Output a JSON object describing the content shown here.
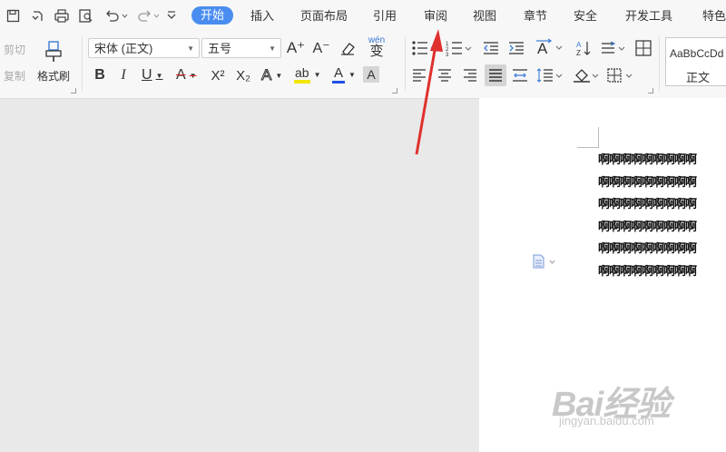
{
  "tabs": [
    "开始",
    "插入",
    "页面布局",
    "引用",
    "审阅",
    "视图",
    "章节",
    "安全",
    "开发工具",
    "特色"
  ],
  "quick_access": [
    "save-icon",
    "redo-file-icon",
    "print-icon",
    "print-preview-icon",
    "undo-icon",
    "redo-icon",
    "customize-icon"
  ],
  "clipboard": {
    "cut": "剪切",
    "copy": "复制",
    "format_painter": "格式刷"
  },
  "font": {
    "name": "宋体 (正文)",
    "size": "五号"
  },
  "font_buttons": {
    "bold": "B",
    "italic": "I",
    "underline": "U",
    "strike": "A",
    "superscript": "X²",
    "subscript": "X₂",
    "text_effect": "A",
    "highlight": "ab",
    "font_color": "A",
    "char_shading": "A",
    "grow": "A⁺",
    "shrink": "A⁻",
    "phonetic": "wén"
  },
  "styles": {
    "sample": "AaBbCcDd",
    "name": "正文"
  },
  "colors": {
    "accent": "#4a8df0",
    "arrow": "#e0312e",
    "highlight_yellow": "#f2e600",
    "font_red": "#e02020",
    "font_blue": "#1e50e6"
  },
  "document": {
    "lines": [
      "啊啊啊啊啊啊啊啊啊",
      "啊啊啊啊啊啊啊啊啊",
      "啊啊啊啊啊啊啊啊啊",
      "啊啊啊啊啊啊啊啊啊",
      "啊啊啊啊啊啊啊啊啊",
      "啊啊啊啊啊啊啊啊啊"
    ]
  },
  "watermark": {
    "logo": "Bai经验",
    "url": "jingyan.baidu.com"
  }
}
